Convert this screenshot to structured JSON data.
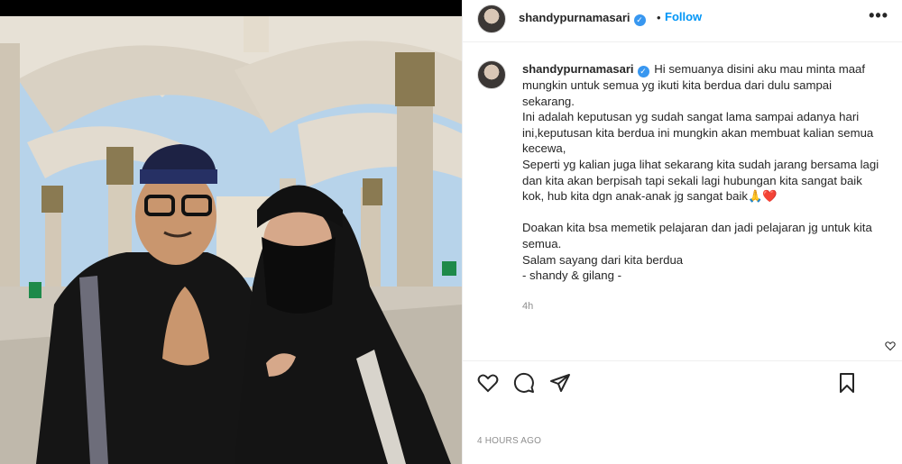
{
  "post": {
    "username": "shandypurnamasari",
    "follow_label": "Follow",
    "dot": "•",
    "more_label": "•••",
    "verified_mark": "✓",
    "caption": "Hi semuanya disini aku mau minta maaf mungkin untuk semua yg ikuti kita berdua dari dulu sampai sekarang.\nIni adalah keputusan yg sudah sangat lama sampai adanya hari ini,keputusan kita berdua ini mungkin akan membuat kalian semua kecewa,\nSeperti yg kalian juga lihat sekarang kita sudah jarang bersama lagi dan kita akan berpisah tapi sekali lagi hubungan kita sangat baik kok, hub kita dgn anak-anak jg sangat baik🙏❤️\n\nDoakan kita bsa memetik pelajaran dan jadi pelajaran jg untuk kita semua.\nSalam sayang dari kita berdua\n- shandy & gilang -",
    "caption_age": "4h",
    "date": "4 HOURS AGO"
  },
  "icons": {
    "like": "heart-icon",
    "comment": "comment-icon",
    "share": "share-icon",
    "save": "bookmark-icon",
    "more": "more-icon",
    "verified": "verified-badge-icon"
  },
  "colors": {
    "link_blue": "#0095f6",
    "verified_blue": "#3897f0",
    "muted_text": "#8e8e8e",
    "text": "#262626"
  }
}
